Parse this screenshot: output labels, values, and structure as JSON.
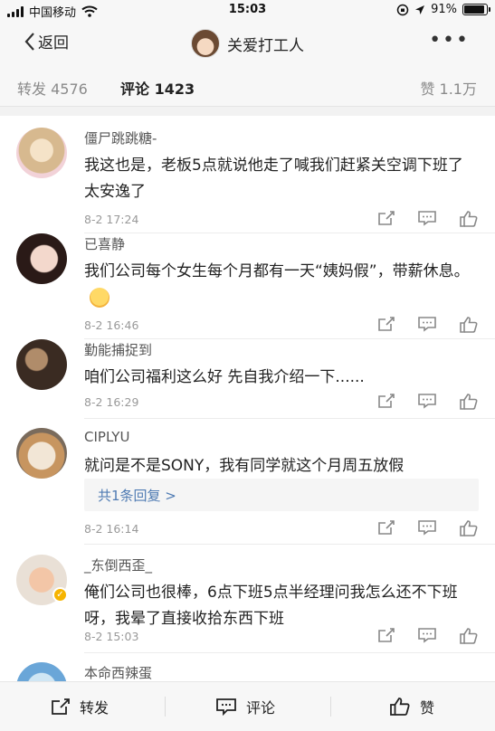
{
  "status": {
    "carrier": "中国移动",
    "time": "15:03",
    "battery": "91%",
    "battery_level": 0.91
  },
  "nav": {
    "back_label": "返回",
    "title": "关爱打工人",
    "more": "•••"
  },
  "tabs": {
    "repost": "转发 4576",
    "comment": "评论 1423",
    "like": "赞 1.1万"
  },
  "comments": [
    {
      "name": "僵尸跳跳糖-",
      "text": "我这也是，老板5点就说他走了喊我们赶紧关空调下班了太安逸了",
      "time": "8-2 17:24"
    },
    {
      "name": "已喜静",
      "text": "我们公司每个女生每个月都有一天“姨妈假”，带薪休息。",
      "time": "8-2 16:46"
    },
    {
      "name": "勤能捕捉到",
      "text": "咱们公司福利这么好 先自我介绍一下......",
      "time": "8-2 16:29"
    },
    {
      "name": "CIPLYU",
      "text": "就问是不是SONY，我有同学就这个月周五放假",
      "reply": "共1条回复 >",
      "time": "8-2 16:14"
    },
    {
      "name": "_东倒西歪_",
      "text": "俺们公司也很棒，6点下班5点半经理问我怎么还不下班呀，我晕了直接收拾东西下班",
      "time": "8-2 15:03"
    },
    {
      "name": "本命西辣蛋"
    }
  ],
  "bottom": {
    "repost": "转发",
    "comment": "评论",
    "like": "赞"
  }
}
